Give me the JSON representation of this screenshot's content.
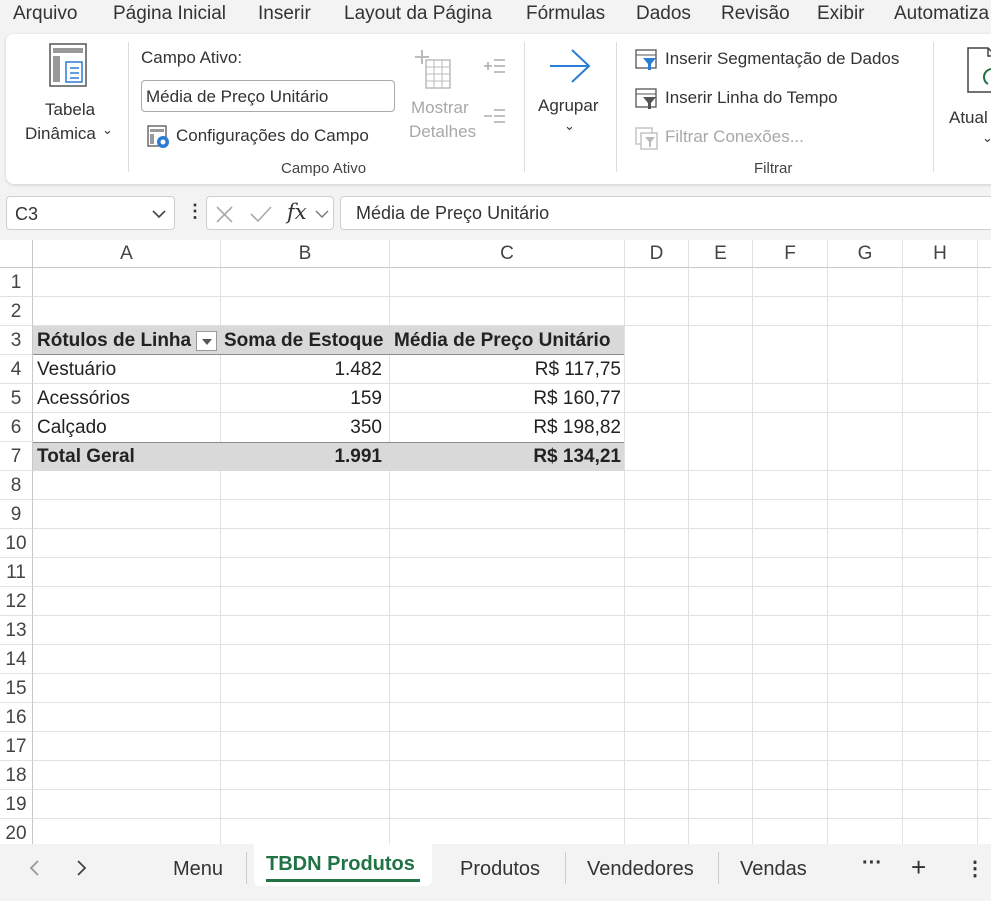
{
  "menubar": {
    "items": [
      "Arquivo",
      "Página Inicial",
      "Inserir",
      "Layout da Página",
      "Fórmulas",
      "Dados",
      "Revisão",
      "Exibir",
      "Automatiza"
    ]
  },
  "ribbon": {
    "pivot_table_label": [
      "Tabela",
      "Dinâmica"
    ],
    "active_field_label": "Campo Ativo:",
    "active_field_value": "Média de Preço Unitário",
    "field_settings_label": "Configurações do Campo",
    "show_details_label": [
      "Mostrar",
      "Detalhes"
    ],
    "group_label": "Agrupar",
    "insert_slicer_label": "Inserir Segmentação de Dados",
    "insert_timeline_label": "Inserir Linha do Tempo",
    "filter_connections_label": "Filtrar Conexões...",
    "refresh_label": "Atual",
    "group_active_field": "Campo Ativo",
    "group_filter": "Filtrar"
  },
  "formula_bar": {
    "name_box": "C3",
    "fx": "fx",
    "formula": "Média de Preço Unitário"
  },
  "columns": [
    "A",
    "B",
    "C",
    "D",
    "E",
    "F",
    "G",
    "H"
  ],
  "rows": [
    "1",
    "2",
    "3",
    "4",
    "5",
    "6",
    "7",
    "8",
    "9",
    "10",
    "11",
    "12",
    "13",
    "14",
    "15",
    "16",
    "17",
    "18",
    "19",
    "20"
  ],
  "pivot": {
    "headers": [
      "Rótulos de Linha",
      "Soma de Estoque",
      "Média de Preço Unitário"
    ],
    "data": [
      [
        "Vestuário",
        "1.482",
        "R$ 117,75"
      ],
      [
        "Acessórios",
        "159",
        "R$ 160,77"
      ],
      [
        "Calçado",
        "350",
        "R$ 198,82"
      ]
    ],
    "total": [
      "Total Geral",
      "1.991",
      "R$ 134,21"
    ]
  },
  "sheet_tabs": [
    "Menu",
    "TBDN Produtos",
    "Produtos",
    "Vendedores",
    "Vendas"
  ],
  "active_tab": "TBDN Produtos",
  "colors": {
    "accent": "#217346",
    "header_fill": "#d9d9d9",
    "icon_blue": "#2b7cd3"
  }
}
